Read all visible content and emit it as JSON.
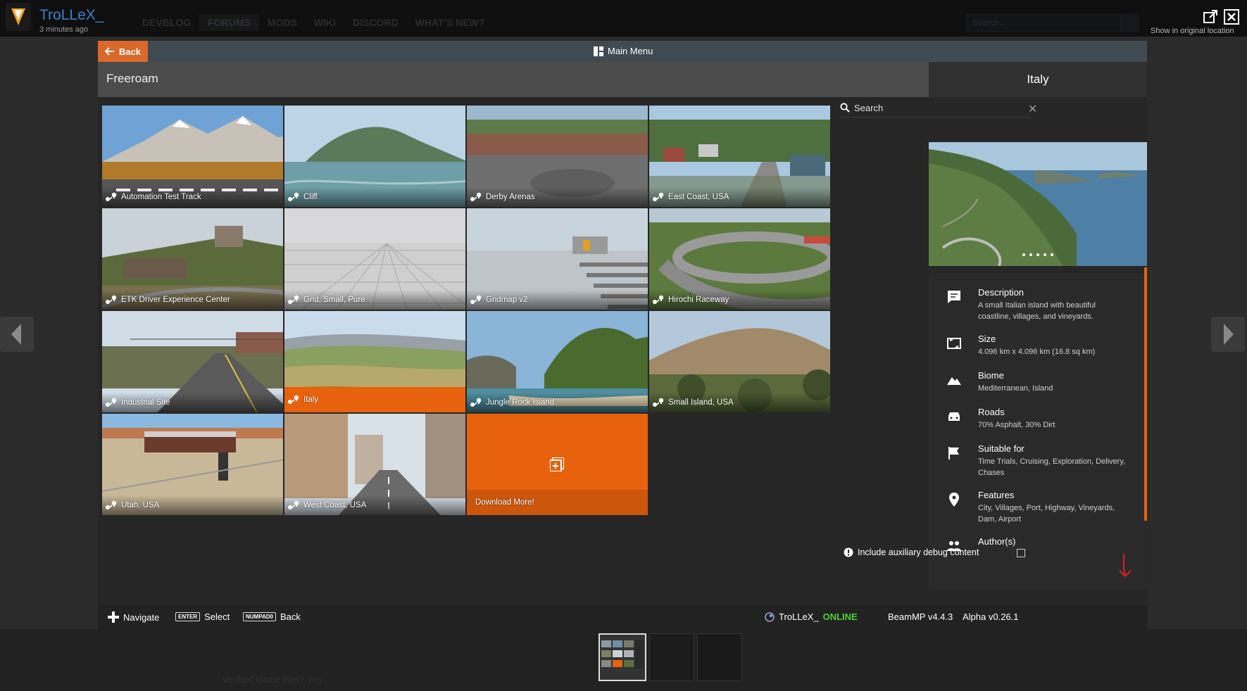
{
  "forum": {
    "user": "TroLLeX_",
    "time": "3 minutes ago",
    "nav": [
      "DEVBLOG",
      "FORUMS",
      "MODS",
      "WIKI",
      "DISCORD",
      "WHAT'S NEW?"
    ],
    "search_placeholder": "Search...",
    "show_original": "Show in original location",
    "bg_text": "Verified Game files? Yes"
  },
  "game": {
    "back_label": "Back",
    "main_menu_label": "Main Menu",
    "section_title": "Freeroam",
    "selected_title": "Italy",
    "search_label": "Search",
    "maps": [
      {
        "name": "Automation Test Track",
        "scene": "mountain"
      },
      {
        "name": "Cliff",
        "scene": "sea-island"
      },
      {
        "name": "Derby Arenas",
        "scene": "arena"
      },
      {
        "name": "East Coast, USA",
        "scene": "town"
      },
      {
        "name": "ETK Driver Experience Center",
        "scene": "castle"
      },
      {
        "name": "Grid, Small, Pure",
        "scene": "grid"
      },
      {
        "name": "Gridmap v2",
        "scene": "gridmap"
      },
      {
        "name": "Hirochi Raceway",
        "scene": "raceway"
      },
      {
        "name": "Industrial Site",
        "scene": "road"
      },
      {
        "name": "Italy",
        "scene": "hills"
      },
      {
        "name": "Jungle Rock Island",
        "scene": "jungle"
      },
      {
        "name": "Small Island, USA",
        "scene": "scrub"
      },
      {
        "name": "Utah, USA",
        "scene": "desert"
      },
      {
        "name": "West Coast, USA",
        "scene": "city"
      }
    ],
    "download_label": "Download More!",
    "details": [
      {
        "icon": "description-icon",
        "title": "Description",
        "text": "A small Italian island with beautiful coastline, villages, and vineyards."
      },
      {
        "icon": "size-icon",
        "title": "Size",
        "text": "4.096 km x 4.096 km (16.8 sq km)"
      },
      {
        "icon": "biome-icon",
        "title": "Biome",
        "text": "Mediterranean, Island"
      },
      {
        "icon": "car-icon",
        "title": "Roads",
        "text": "70% Asphalt, 30% Dirt"
      },
      {
        "icon": "flag-icon",
        "title": "Suitable for",
        "text": "Time Trials, Cruising, Exploration, Delivery, Chases"
      },
      {
        "icon": "pin-icon",
        "title": "Features",
        "text": "City, Villages, Port, Highway, Vineyards, Dam, Airport"
      },
      {
        "icon": "people-icon",
        "title": "Author(s)",
        "text": ""
      }
    ],
    "debug_label": "Include auxiliary debug content",
    "debug_checked": false,
    "footer": {
      "navigate": "Navigate",
      "enter_key": "ENTER",
      "select": "Select",
      "numpad_key": "NUMPAD0",
      "back": "Back",
      "user": "TroLLeX_",
      "status": "ONLINE",
      "beammp": "BeamMP v4.4.3",
      "alpha": "Alpha v0.26.1"
    }
  },
  "colors": {
    "accent": "#e8620e",
    "online": "#4cd137",
    "header": "#3f4a52"
  }
}
